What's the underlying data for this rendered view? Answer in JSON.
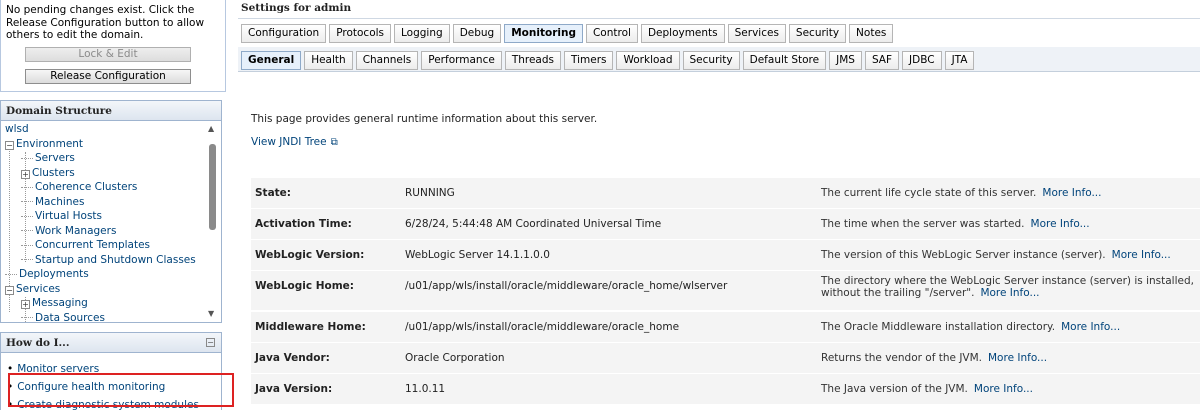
{
  "change_center": {
    "message": "No pending changes exist. Click the Release Configuration button to allow others to edit the domain.",
    "lock_edit_label": "Lock & Edit",
    "release_label": "Release Configuration"
  },
  "domain_structure": {
    "title": "Domain Structure",
    "nodes": [
      {
        "label": "wlsd"
      },
      {
        "label": "Environment",
        "expander": "−"
      },
      {
        "label": "Servers"
      },
      {
        "label": "Clusters",
        "expander": "+"
      },
      {
        "label": "Coherence Clusters"
      },
      {
        "label": "Machines"
      },
      {
        "label": "Virtual Hosts"
      },
      {
        "label": "Work Managers"
      },
      {
        "label": "Concurrent Templates"
      },
      {
        "label": "Startup and Shutdown Classes"
      },
      {
        "label": "Deployments"
      },
      {
        "label": "Services",
        "expander": "−"
      },
      {
        "label": "Messaging",
        "expander": "+"
      },
      {
        "label": "Data Sources"
      }
    ]
  },
  "how_do_i": {
    "title": "How do I...",
    "collapse_icon": "−",
    "items": [
      "Monitor servers",
      "Configure health monitoring",
      "Create diagnostic system modules"
    ]
  },
  "settings": {
    "title": "Settings for admin",
    "tabs": [
      "Configuration",
      "Protocols",
      "Logging",
      "Debug",
      "Monitoring",
      "Control",
      "Deployments",
      "Services",
      "Security",
      "Notes"
    ],
    "active_tab": "Monitoring",
    "subtabs": [
      "General",
      "Health",
      "Channels",
      "Performance",
      "Threads",
      "Timers",
      "Workload",
      "Security",
      "Default Store",
      "JMS",
      "SAF",
      "JDBC",
      "JTA"
    ],
    "active_subtab": "General",
    "intro": "This page provides general runtime information about this server.",
    "jndi_link": "View JNDI Tree",
    "more_info": "More Info...",
    "rows": [
      {
        "label": "State:",
        "value": "RUNNING",
        "desc": "The current life cycle state of this server."
      },
      {
        "label": "Activation Time:",
        "value": "6/28/24, 5:44:48 AM Coordinated Universal Time",
        "desc": "The time when the server was started."
      },
      {
        "label": "WebLogic Version:",
        "value": "WebLogic Server 14.1.1.0.0",
        "desc": "The version of this WebLogic Server instance (server)."
      },
      {
        "label": "WebLogic Home:",
        "value": "/u01/app/wls/install/oracle/middleware/oracle_home/wlserver",
        "desc": "The directory where the WebLogic Server instance (server) is installed, without the trailing \"/server\"."
      },
      {
        "label": "Middleware Home:",
        "value": "/u01/app/wls/install/oracle/middleware/oracle_home",
        "desc": "The Oracle Middleware installation directory."
      },
      {
        "label": "Java Vendor:",
        "value": "Oracle Corporation",
        "desc": "Returns the vendor of the JVM."
      },
      {
        "label": "Java Version:",
        "value": "11.0.11",
        "desc": "The Java version of the JVM."
      }
    ]
  },
  "colors": {
    "link": "#00437a",
    "highlight": "#dd2222",
    "active_tab": "#e6f0fb"
  }
}
